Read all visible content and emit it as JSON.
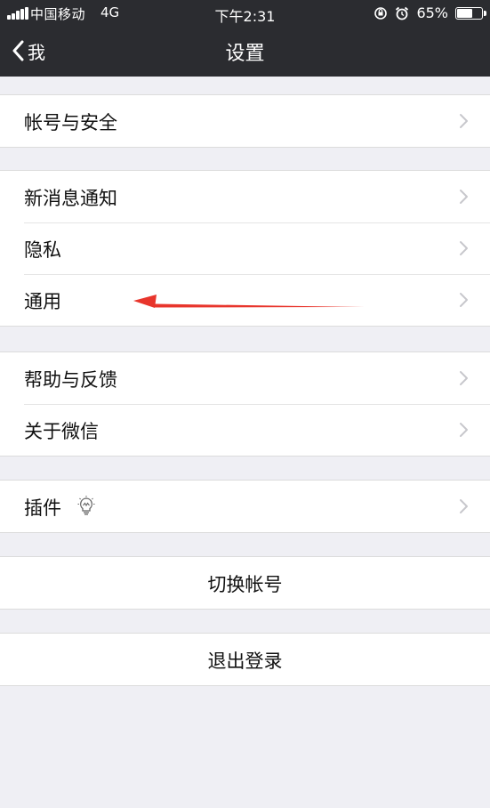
{
  "status_bar": {
    "carrier": "中国移动",
    "network": "4G",
    "time": "下午2:31",
    "battery_percent": "65%",
    "battery_level": 0.65,
    "icons": [
      "signal-bars-icon",
      "rotation-lock-icon",
      "alarm-icon",
      "battery-icon"
    ]
  },
  "nav": {
    "back_label": "我",
    "title": "设置"
  },
  "groups": {
    "account": {
      "items": [
        {
          "label": "帐号与安全"
        }
      ]
    },
    "general": {
      "items": [
        {
          "label": "新消息通知"
        },
        {
          "label": "隐私"
        },
        {
          "label": "通用"
        }
      ]
    },
    "help": {
      "items": [
        {
          "label": "帮助与反馈"
        },
        {
          "label": "关于微信"
        }
      ]
    },
    "plugins": {
      "items": [
        {
          "label": "插件",
          "icon": "bulb-icon"
        }
      ]
    },
    "switch_account": {
      "label": "切换帐号"
    },
    "logout": {
      "label": "退出登录"
    }
  },
  "annotation": {
    "type": "arrow",
    "color": "#e8352c",
    "points_to": "通用"
  },
  "colors": {
    "header_bg": "#2b2c30",
    "page_bg": "#efeff4",
    "cell_bg": "#ffffff",
    "chevron": "#c7c7cc"
  }
}
